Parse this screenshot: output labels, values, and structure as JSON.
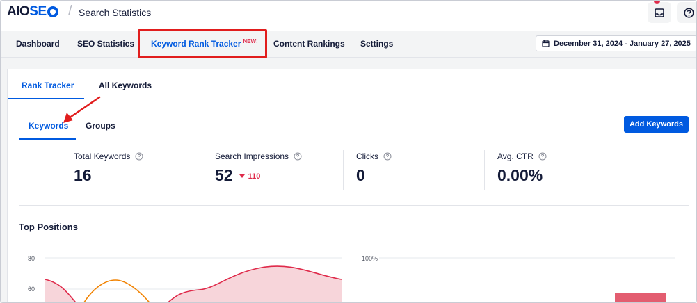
{
  "header": {
    "logo_prefix": "AIO",
    "logo_suffix": "SE",
    "page_title": "Search Statistics"
  },
  "mainnav": {
    "items": [
      {
        "label": "Dashboard"
      },
      {
        "label": "SEO Statistics"
      },
      {
        "label": "Keyword Rank Tracker",
        "badge": "NEW!"
      },
      {
        "label": "Content Rankings"
      },
      {
        "label": "Settings"
      }
    ],
    "date_range": "December 31, 2024 - January 27, 2025"
  },
  "subtabs": {
    "items": [
      {
        "label": "Rank Tracker"
      },
      {
        "label": "All Keywords"
      }
    ]
  },
  "innertabs": {
    "items": [
      {
        "label": "Keywords"
      },
      {
        "label": "Groups"
      }
    ],
    "add_button": "Add Keywords"
  },
  "stats": [
    {
      "label": "Total Keywords",
      "value": "16"
    },
    {
      "label": "Search Impressions",
      "value": "52",
      "delta": "110"
    },
    {
      "label": "Clicks",
      "value": "0"
    },
    {
      "label": "Avg. CTR",
      "value": "0.00%"
    }
  ],
  "top_positions": {
    "title": "Top Positions",
    "left_axis_ticks": [
      "80",
      "60"
    ],
    "right_axis_ticks": [
      "100%"
    ]
  },
  "colors": {
    "accent": "#005ae0",
    "danger": "#df2a4a",
    "highlight": "#e11d1d",
    "area_red": "#f7d5da",
    "line_red": "#df2a4a",
    "line_orange": "#f18200",
    "bar_red": "#e35d70"
  }
}
